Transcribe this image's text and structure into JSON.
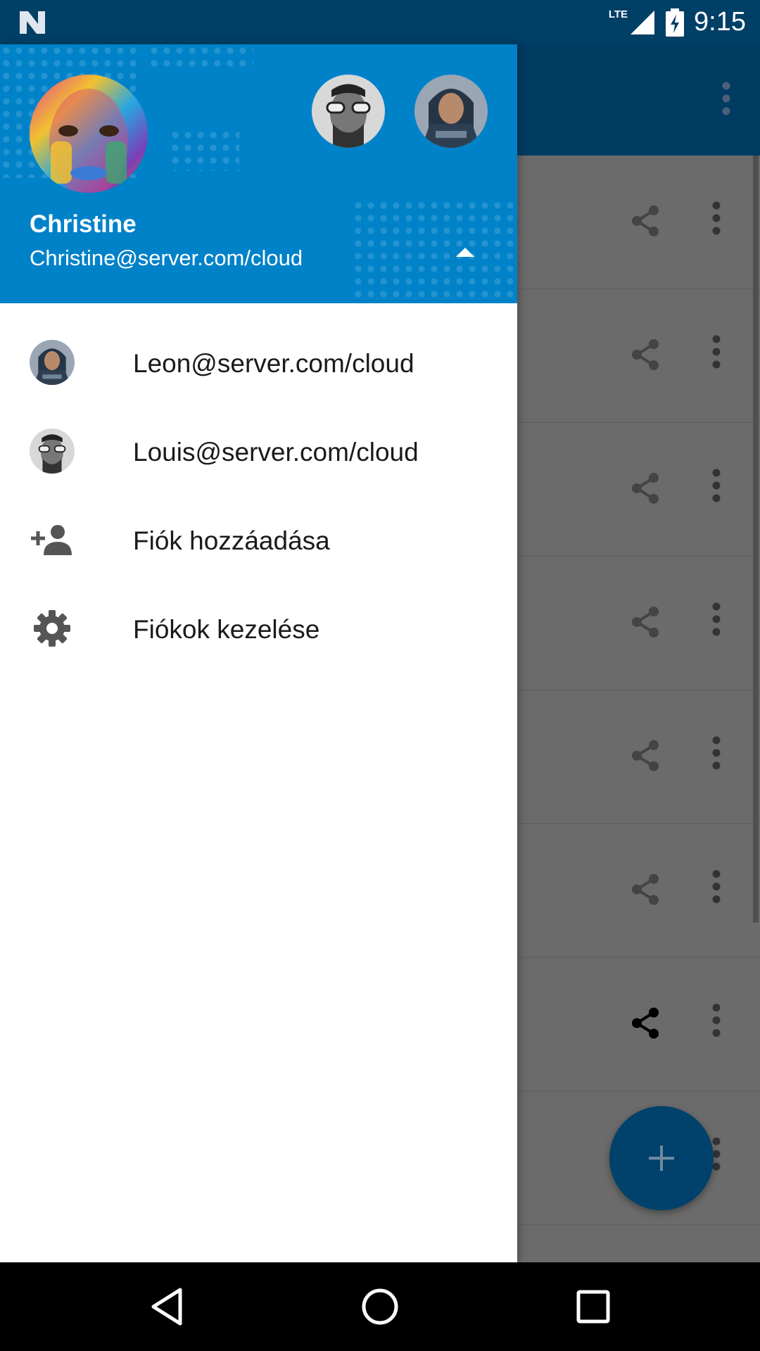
{
  "status_bar": {
    "network_label": "LTE",
    "time": "9:15",
    "icons": [
      "notification-n-icon",
      "signal-icon",
      "battery-charging-icon"
    ]
  },
  "drawer": {
    "user": {
      "name": "Christine",
      "email": "Christine@server.com/cloud"
    },
    "accounts": [
      {
        "label": "Leon@server.com/cloud"
      },
      {
        "label": "Louis@server.com/cloud"
      }
    ],
    "actions": [
      {
        "label": "Fiók hozzáadása",
        "icon": "person-add-icon"
      },
      {
        "label": "Fiókok kezelése",
        "icon": "gear-icon"
      }
    ]
  },
  "background_app": {
    "row_icons": [
      "share-icon",
      "more-vert-icon"
    ],
    "fab_icon": "plus-icon"
  },
  "nav_bar": {
    "icons": [
      "back-icon",
      "home-icon",
      "recents-icon"
    ]
  },
  "colors": {
    "header_blue": "#0082c9",
    "toolbar_dark": "#003b62",
    "status_bar": "#003f66",
    "scrim_gray": "#6b6b6b"
  }
}
